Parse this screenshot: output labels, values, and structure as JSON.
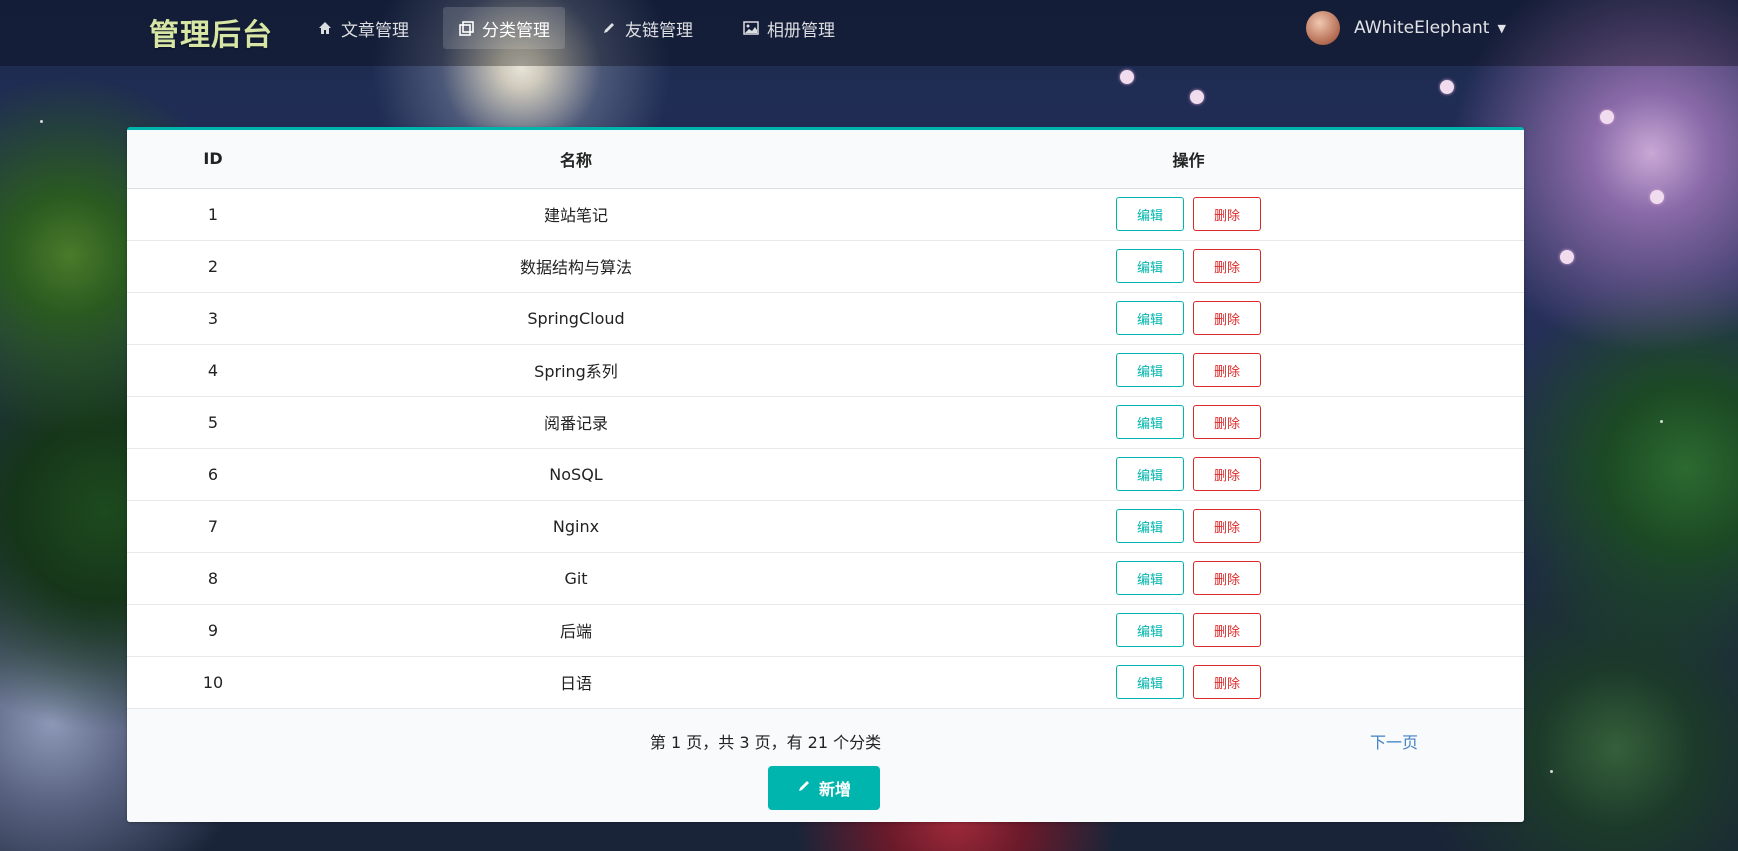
{
  "header": {
    "logo": "管理后台",
    "nav": [
      {
        "label": "文章管理",
        "icon": "home-icon"
      },
      {
        "label": "分类管理",
        "icon": "copy-icon"
      },
      {
        "label": "友链管理",
        "icon": "pencil-icon"
      },
      {
        "label": "相册管理",
        "icon": "image-icon"
      }
    ],
    "user": {
      "name": "AWhiteElephant",
      "icon": "chevron-down-icon"
    }
  },
  "table": {
    "headers": {
      "id": "ID",
      "name": "名称",
      "ops": "操作"
    },
    "rows": [
      {
        "id": "1",
        "name": "建站笔记"
      },
      {
        "id": "2",
        "name": "数据结构与算法"
      },
      {
        "id": "3",
        "name": "SpringCloud"
      },
      {
        "id": "4",
        "name": "Spring系列"
      },
      {
        "id": "5",
        "name": "阅番记录"
      },
      {
        "id": "6",
        "name": "NoSQL"
      },
      {
        "id": "7",
        "name": "Nginx"
      },
      {
        "id": "8",
        "name": "Git"
      },
      {
        "id": "9",
        "name": "后端"
      },
      {
        "id": "10",
        "name": "日语"
      }
    ],
    "edit_label": "编辑",
    "delete_label": "删除"
  },
  "pagination": {
    "info": "第 1 页，共 3 页，有 21 个分类",
    "next_label": "下一页"
  },
  "add_button": {
    "label": "新增",
    "icon": "pencil-icon"
  },
  "colors": {
    "accent": "#00b5ad",
    "danger": "#db2828",
    "link": "#4183c4"
  }
}
